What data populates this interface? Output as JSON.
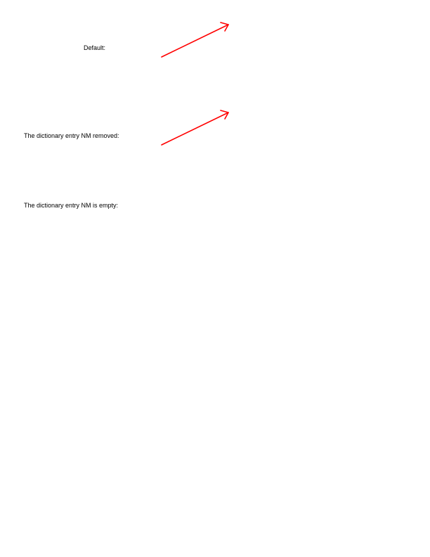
{
  "rows": [
    {
      "label": "Default:",
      "annotation": {
        "shape": "line-arrow",
        "color": "#ff0000"
      }
    },
    {
      "label": "The dictionary entry NM removed:",
      "annotation": {
        "shape": "line-arrow",
        "color": "#ff0000"
      }
    },
    {
      "label": "The dictionary entry NM is empty:",
      "annotation": null
    }
  ]
}
